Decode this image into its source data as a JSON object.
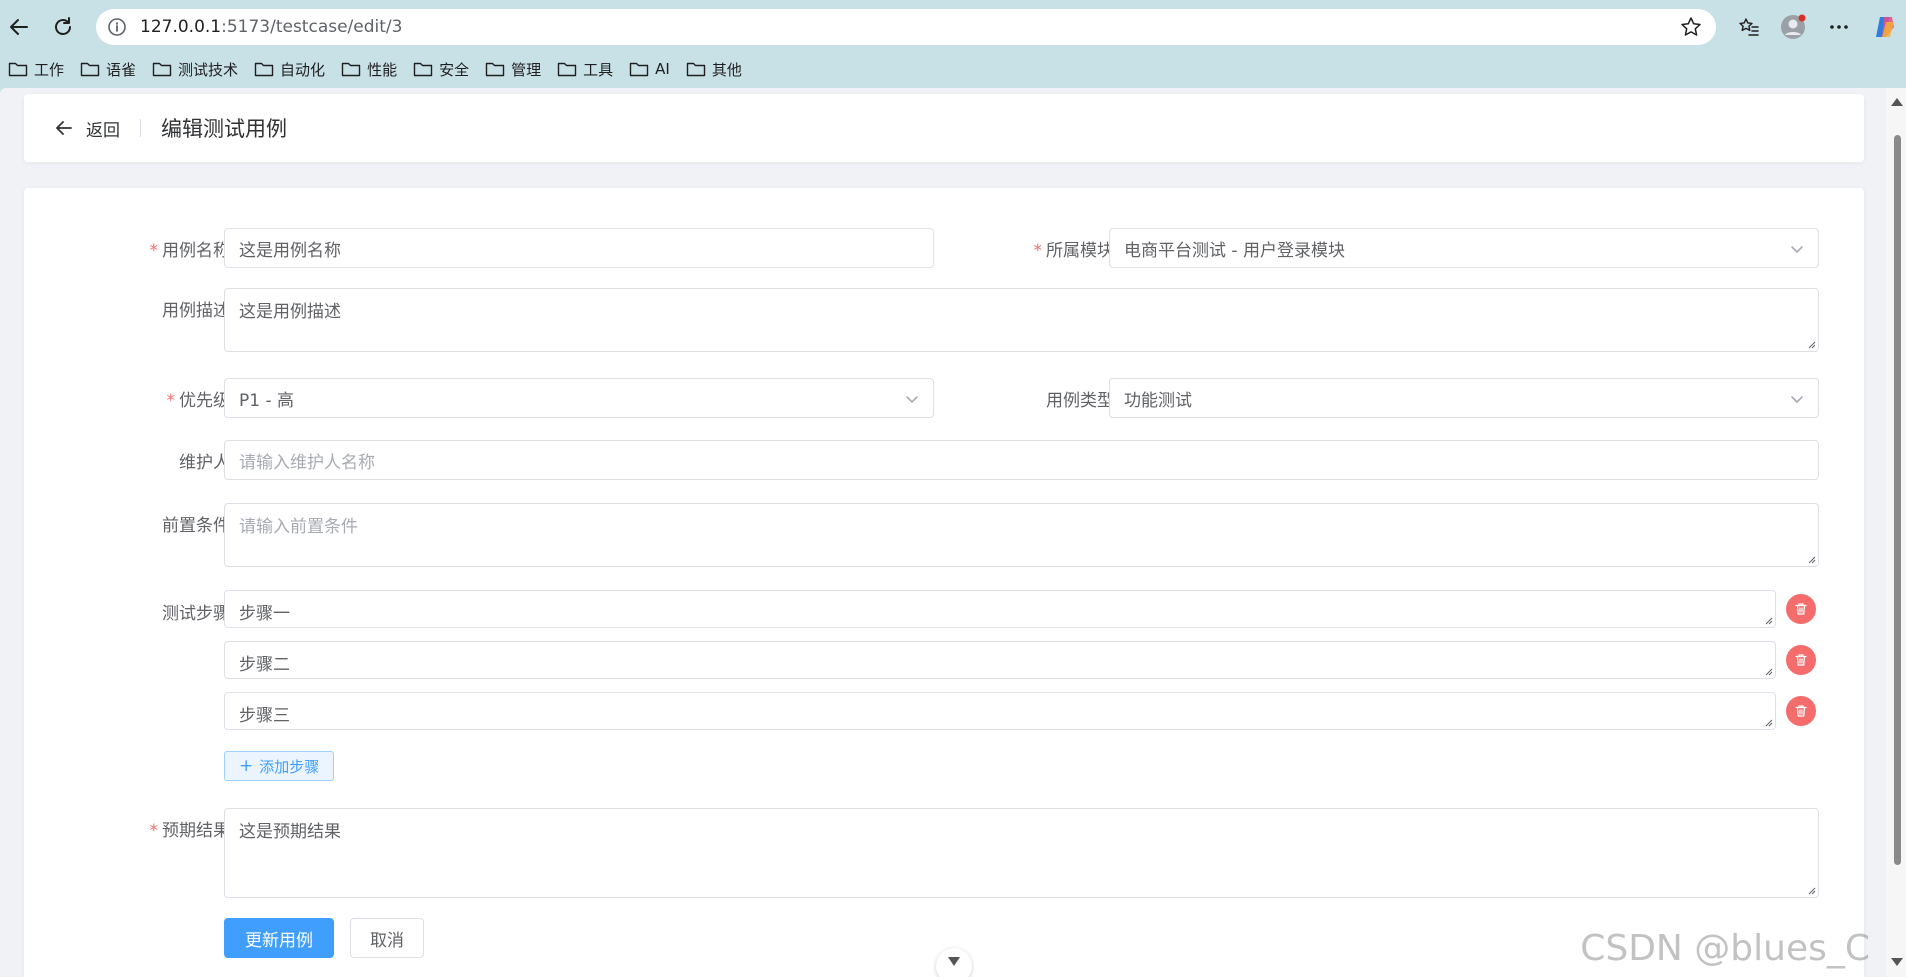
{
  "browser": {
    "url_host": "127.0.0.1",
    "url_rest": ":5173/testcase/edit/3",
    "bookmarks": [
      "工作",
      "语雀",
      "测试技术",
      "自动化",
      "性能",
      "安全",
      "管理",
      "工具",
      "AI",
      "其他"
    ]
  },
  "header": {
    "back_label": "返回",
    "title": "编辑测试用例"
  },
  "form": {
    "name": {
      "label": "用例名称",
      "required": true,
      "value": "这是用例名称"
    },
    "module": {
      "label": "所属模块",
      "required": true,
      "value": "电商平台测试 - 用户登录模块"
    },
    "description": {
      "label": "用例描述",
      "value": "这是用例描述"
    },
    "priority": {
      "label": "优先级",
      "required": true,
      "value": "P1 - 高"
    },
    "type": {
      "label": "用例类型",
      "value": "功能测试"
    },
    "maintainer": {
      "label": "维护人",
      "placeholder": "请输入维护人名称",
      "value": ""
    },
    "precondition": {
      "label": "前置条件",
      "placeholder": "请输入前置条件",
      "value": ""
    },
    "steps": {
      "label": "测试步骤",
      "items": [
        "步骤一",
        "步骤二",
        "步骤三"
      ],
      "add_label": "添加步骤"
    },
    "expected": {
      "label": "预期结果",
      "required": true,
      "value": "这是预期结果"
    },
    "submit_label": "更新用例",
    "cancel_label": "取消"
  },
  "required_mark": "*",
  "watermark": "CSDN @blues_C",
  "colors": {
    "primary": "#409eff",
    "danger": "#f56c6c",
    "required": "#f56c6c"
  }
}
